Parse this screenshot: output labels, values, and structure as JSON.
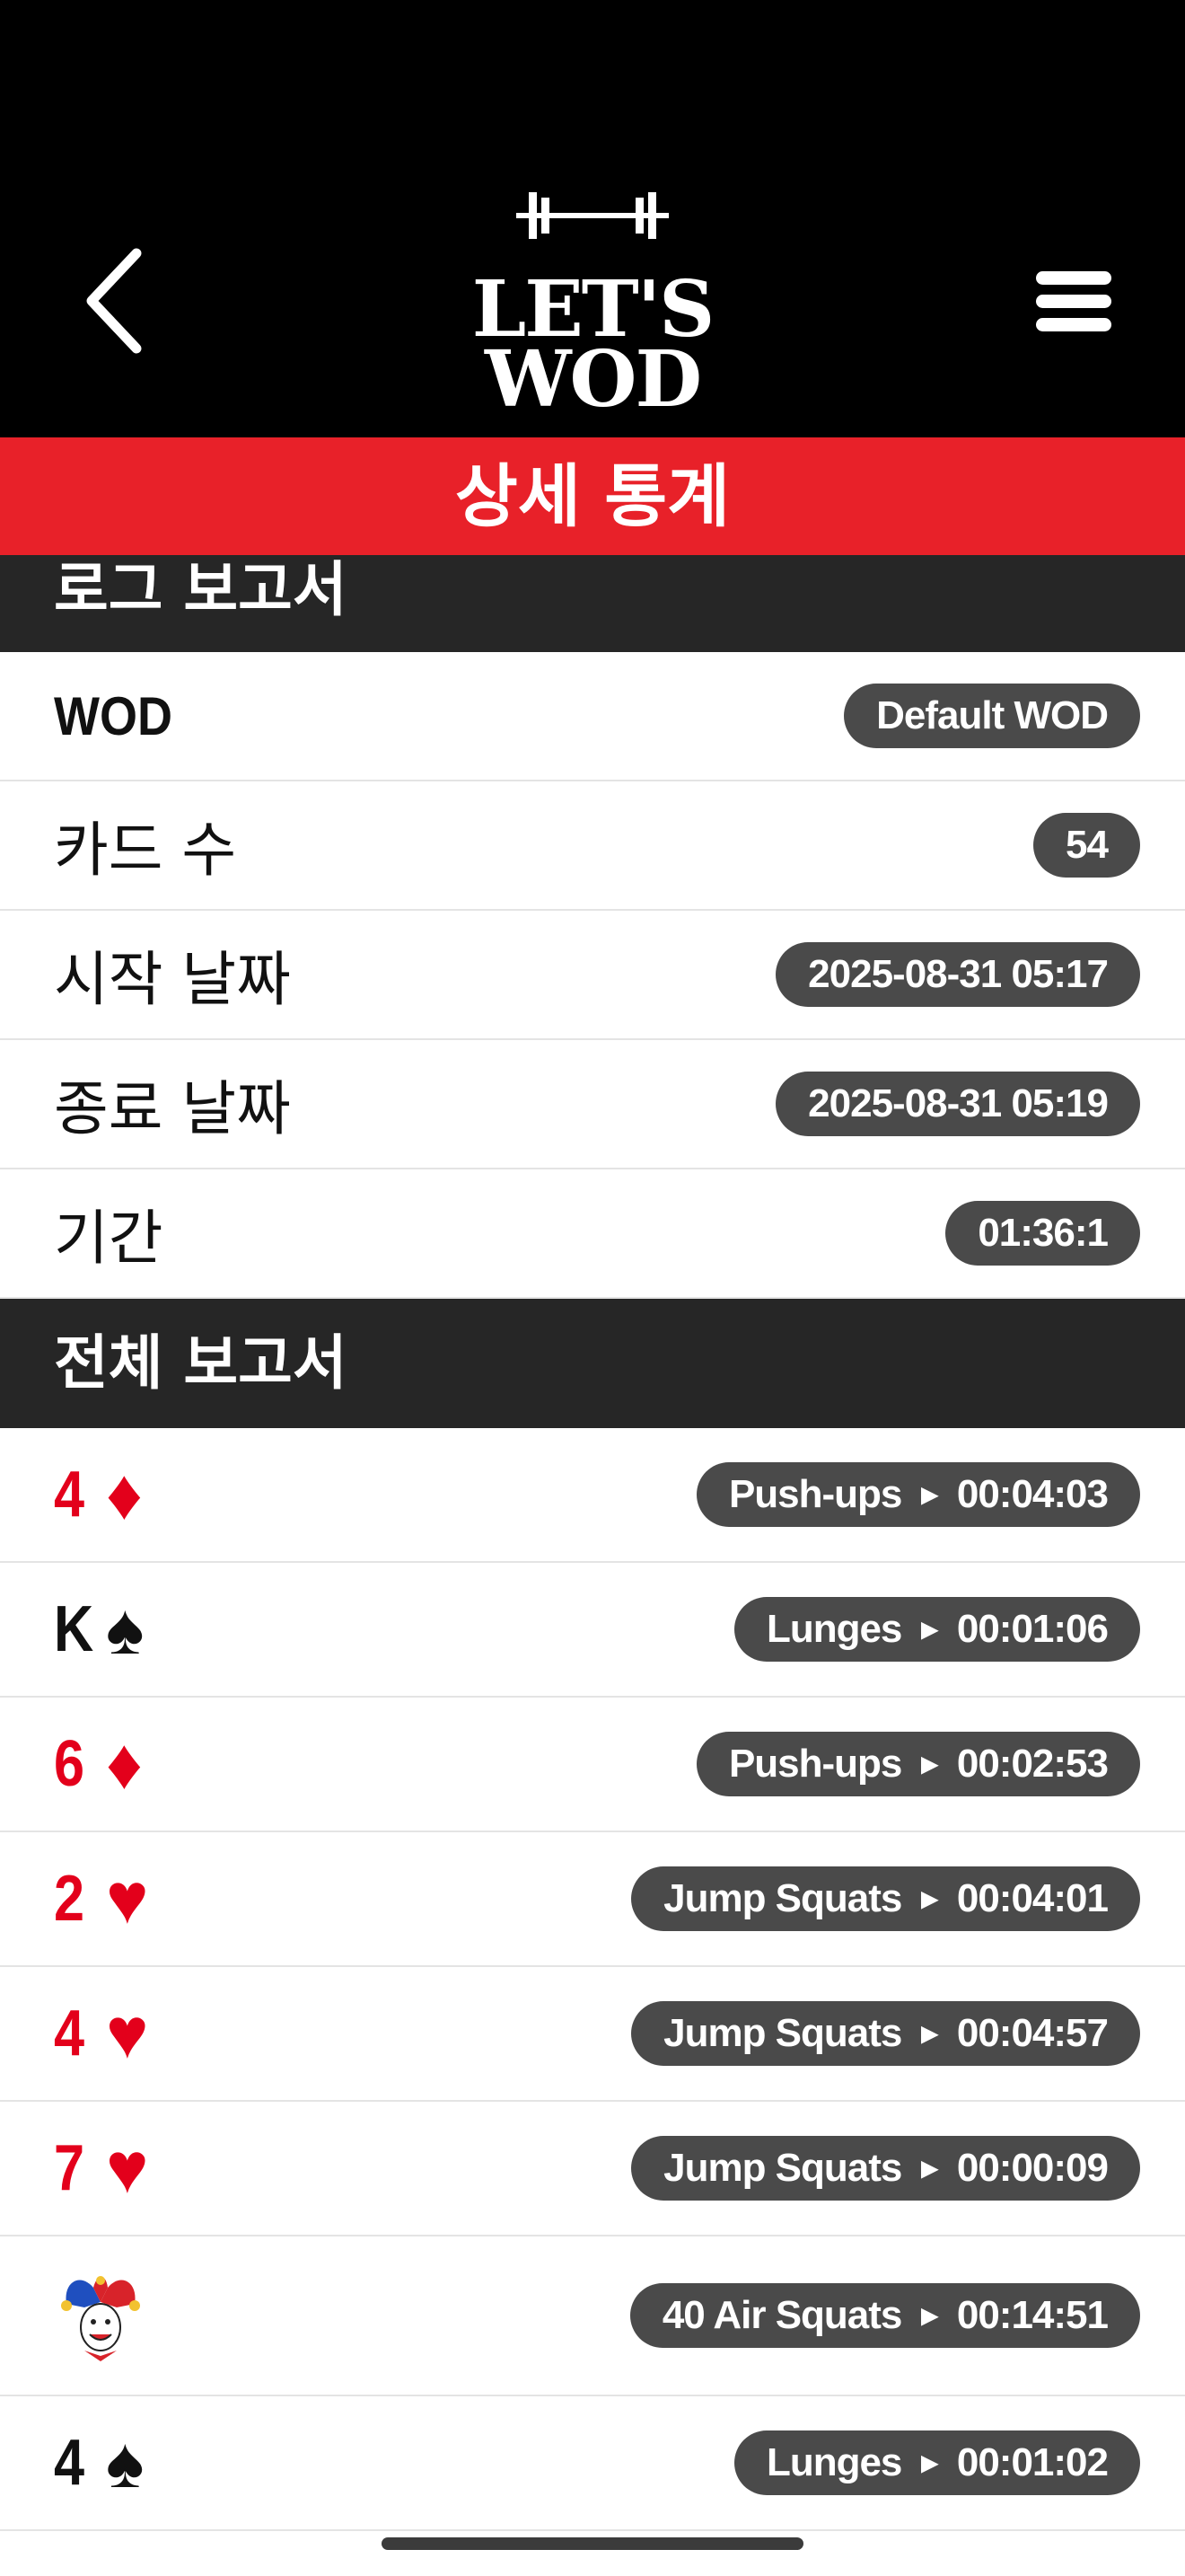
{
  "header": {
    "logo_line1": "LET'S",
    "logo_line2": "WOD",
    "back_icon": "chevron-left-icon",
    "menu_icon": "hamburger-menu-icon"
  },
  "title": "상세 통계",
  "log_report": {
    "heading": "로그 보고서",
    "rows": [
      {
        "label": "WOD",
        "value": "Default WOD"
      },
      {
        "label": "카드 수",
        "value": "54"
      },
      {
        "label": "시작 날짜",
        "value": "2025-08-31 05:17"
      },
      {
        "label": "종료 날짜",
        "value": "2025-08-31 05:19"
      },
      {
        "label": "기간",
        "value": "01:36:1"
      }
    ]
  },
  "full_report": {
    "heading": "전체 보고서",
    "rows": [
      {
        "rank": "4",
        "suit": "♦",
        "color": "red",
        "exercise": "Push-ups",
        "time": "00:04:03"
      },
      {
        "rank": "K",
        "suit": "♠",
        "color": "black",
        "exercise": "Lunges",
        "time": "00:01:06"
      },
      {
        "rank": "6",
        "suit": "♦",
        "color": "red",
        "exercise": "Push-ups",
        "time": "00:02:53"
      },
      {
        "rank": "2",
        "suit": "♥",
        "color": "red",
        "exercise": "Jump Squats",
        "time": "00:04:01"
      },
      {
        "rank": "4",
        "suit": "♥",
        "color": "red",
        "exercise": "Jump Squats",
        "time": "00:04:57"
      },
      {
        "rank": "7",
        "suit": "♥",
        "color": "red",
        "exercise": "Jump Squats",
        "time": "00:00:09"
      },
      {
        "rank": "",
        "suit": "",
        "color": "joker",
        "card_icon": "joker-icon",
        "exercise": "40 Air Squats",
        "time": "00:14:51"
      },
      {
        "rank": "4",
        "suit": "♠",
        "color": "black",
        "exercise": "Lunges",
        "time": "00:01:02"
      }
    ],
    "arrow": "▶"
  },
  "colors": {
    "accent_red": "#e82129",
    "header_black": "#000000",
    "section_dark": "#262626",
    "pill_gray": "#4a4a4a",
    "card_red": "#e3001b"
  }
}
